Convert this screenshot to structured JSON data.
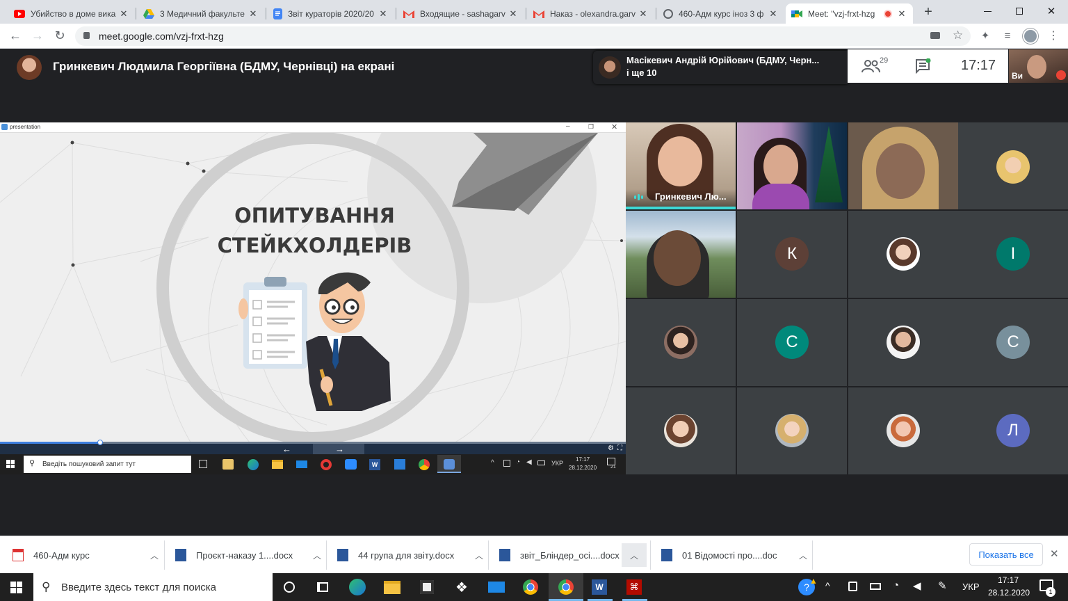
{
  "browser": {
    "tabs": [
      {
        "title": "Убийство в доме вика",
        "color": "#ff0000",
        "kind": "youtube"
      },
      {
        "title": "3 Медичний факульте",
        "color": "#1a73e8",
        "kind": "drive"
      },
      {
        "title": "Звіт кураторів 2020/20",
        "color": "#4285f4",
        "kind": "docs"
      },
      {
        "title": "Входящие - sashagarv",
        "color": "#ea4335",
        "kind": "gmail"
      },
      {
        "title": "Наказ - olexandra.garv",
        "color": "#ea4335",
        "kind": "gmail"
      },
      {
        "title": "460-Адм курс іноз 3 ф",
        "color": "#5f6368",
        "kind": "globe"
      },
      {
        "title": "Meet: \"vzj-frxt-hzg",
        "color": "#00897b",
        "kind": "meet"
      }
    ],
    "new_tab": "+",
    "url": "meet.google.com/vzj-frxt-hzg"
  },
  "meet": {
    "presenter_caption": "Гринкевич Людмила Георгіївна (БДМУ, Чернівці) на екрані",
    "speaker_line1": "Масікевич Андрій Юрійович (БДМУ, Черн...",
    "speaker_line2": "і ще 10",
    "participants_count": "29",
    "clock": "17:17",
    "self_label": "Ви",
    "tile_name": "Гринкевич Лю..."
  },
  "presentation": {
    "window_title": "presentation",
    "slide_line1": "ОПИТУВАННЯ",
    "slide_line2": "СТЕЙКХОЛДЕРІВ",
    "progress_percent": 16,
    "inner_search": "Введіть пошуковий запит тут",
    "inner_lang": "УКР",
    "inner_time": "17:17",
    "inner_date": "28.12.2020",
    "inner_notif": "21"
  },
  "grid": {
    "letters": [
      "К",
      "І",
      "С",
      "С",
      "Л"
    ],
    "colors": {
      "K": "#5d4037",
      "I": "#00796b",
      "C1": "#00897b",
      "C2": "#78909c",
      "L": "#5c6bc0",
      "accent": "#3dd9d6"
    }
  },
  "downloads": {
    "items": [
      "460-Адм курс",
      "Проєкт-наказу 1....docx",
      "44 група для звіту.docx",
      "звіт_Бліндер_осі....docx",
      "01 Відомості про....doc"
    ],
    "show_all": "Показать все"
  },
  "taskbar": {
    "search_placeholder": "Введите здесь текст для поиска",
    "lang": "УКР",
    "time": "17:17",
    "date": "28.12.2020",
    "notif": "1"
  }
}
